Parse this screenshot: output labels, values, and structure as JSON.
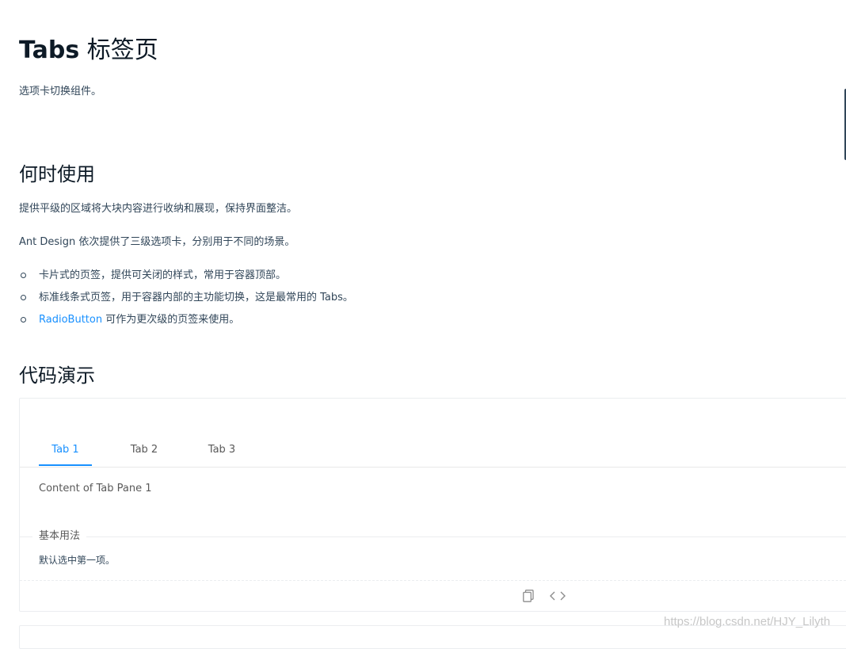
{
  "header": {
    "title_en": "Tabs",
    "title_cn": "标签页",
    "subtitle": "选项卡切换组件。"
  },
  "when_to_use": {
    "heading": "何时使用",
    "p1": "提供平级的区域将大块内容进行收纳和展现，保持界面整洁。",
    "p2": "Ant Design 依次提供了三级选项卡，分别用于不同的场景。",
    "items": [
      {
        "text": "卡片式的页签，提供可关闭的样式，常用于容器顶部。"
      },
      {
        "text": "标准线条式页签，用于容器内部的主功能切换，这是最常用的 Tabs。"
      },
      {
        "link": "RadioButton",
        "text": " 可作为更次级的页签来使用。"
      }
    ]
  },
  "demo": {
    "heading": "代码演示",
    "tabs": [
      {
        "label": "Tab 1",
        "active": true
      },
      {
        "label": "Tab 2",
        "active": false
      },
      {
        "label": "Tab 3",
        "active": false
      }
    ],
    "pane_content": "Content of Tab Pane 1",
    "meta_title": "基本用法",
    "meta_description": "默认选中第一项。",
    "actions": {
      "copy_icon": "copy-icon",
      "code_icon": "code-expand-icon"
    }
  },
  "colors": {
    "accent": "#1890ff",
    "text": "#314659",
    "heading": "#0d1a26",
    "border": "#ebedf0"
  },
  "watermark": "https://blog.csdn.net/HJY_Lilyth"
}
